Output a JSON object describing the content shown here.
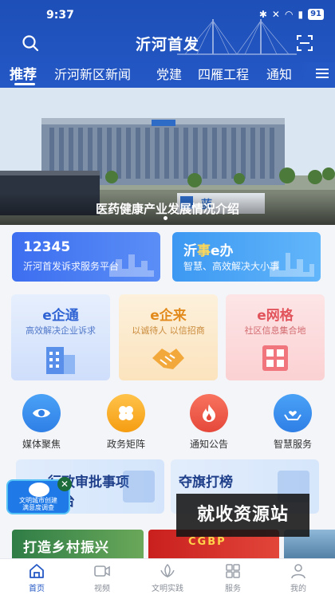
{
  "status_bar": {
    "time": "9:37",
    "battery": "91"
  },
  "header": {
    "title": "沂河首发"
  },
  "tabs": [
    {
      "label": "推荐",
      "active": true
    },
    {
      "label": "沂河新区新闻",
      "active": false
    },
    {
      "label": "党建",
      "active": false
    },
    {
      "label": "四雁工程",
      "active": false
    },
    {
      "label": "通知",
      "active": false
    }
  ],
  "banner": {
    "caption": "医药健康产业发展情况介绍",
    "building_sign": "蓝"
  },
  "service_cards": [
    {
      "title": "12345",
      "subtitle": "沂河首发诉求服务平台"
    },
    {
      "title_prefix": "沂",
      "title_highlight": "事",
      "title_suffix": "e办",
      "subtitle": "智慧、高效解决大小事"
    }
  ],
  "e_cards": [
    {
      "title": "e企通",
      "subtitle": "高效解决企业诉求",
      "icon": "building-icon"
    },
    {
      "title": "e企来",
      "subtitle": "以诚待人 以信招商",
      "icon": "handshake-icon"
    },
    {
      "title": "e网格",
      "subtitle": "社区信息集合地",
      "icon": "grid-icon"
    }
  ],
  "quick_links": [
    {
      "label": "媒体聚焦",
      "icon": "eye-icon"
    },
    {
      "label": "政务矩阵",
      "icon": "clover-icon"
    },
    {
      "label": "通知公告",
      "icon": "flame-icon"
    },
    {
      "label": "智慧服务",
      "icon": "hands-heart-icon"
    }
  ],
  "feature_cards": [
    {
      "title": "行政审批事项",
      "subtitle": "平台"
    },
    {
      "title": "夺旗打榜",
      "subtitle": ""
    }
  ],
  "survey": {
    "lines": [
      "文明城市创建",
      "满意度调查"
    ],
    "close": "✕"
  },
  "watermark": "就收资源站",
  "promos": [
    {
      "text": "打造乡村振兴"
    },
    {
      "text": "CGBP"
    }
  ],
  "bottom_nav": [
    {
      "label": "首页",
      "icon": "home-icon",
      "active": true
    },
    {
      "label": "视频",
      "icon": "video-icon",
      "active": false
    },
    {
      "label": "文明实践",
      "icon": "civilization-icon",
      "active": false
    },
    {
      "label": "服务",
      "icon": "grid-services-icon",
      "active": false
    },
    {
      "label": "我的",
      "icon": "user-icon",
      "active": false
    }
  ],
  "colors": {
    "brand_blue": "#2458c5",
    "nav_active": "#2458c5"
  }
}
